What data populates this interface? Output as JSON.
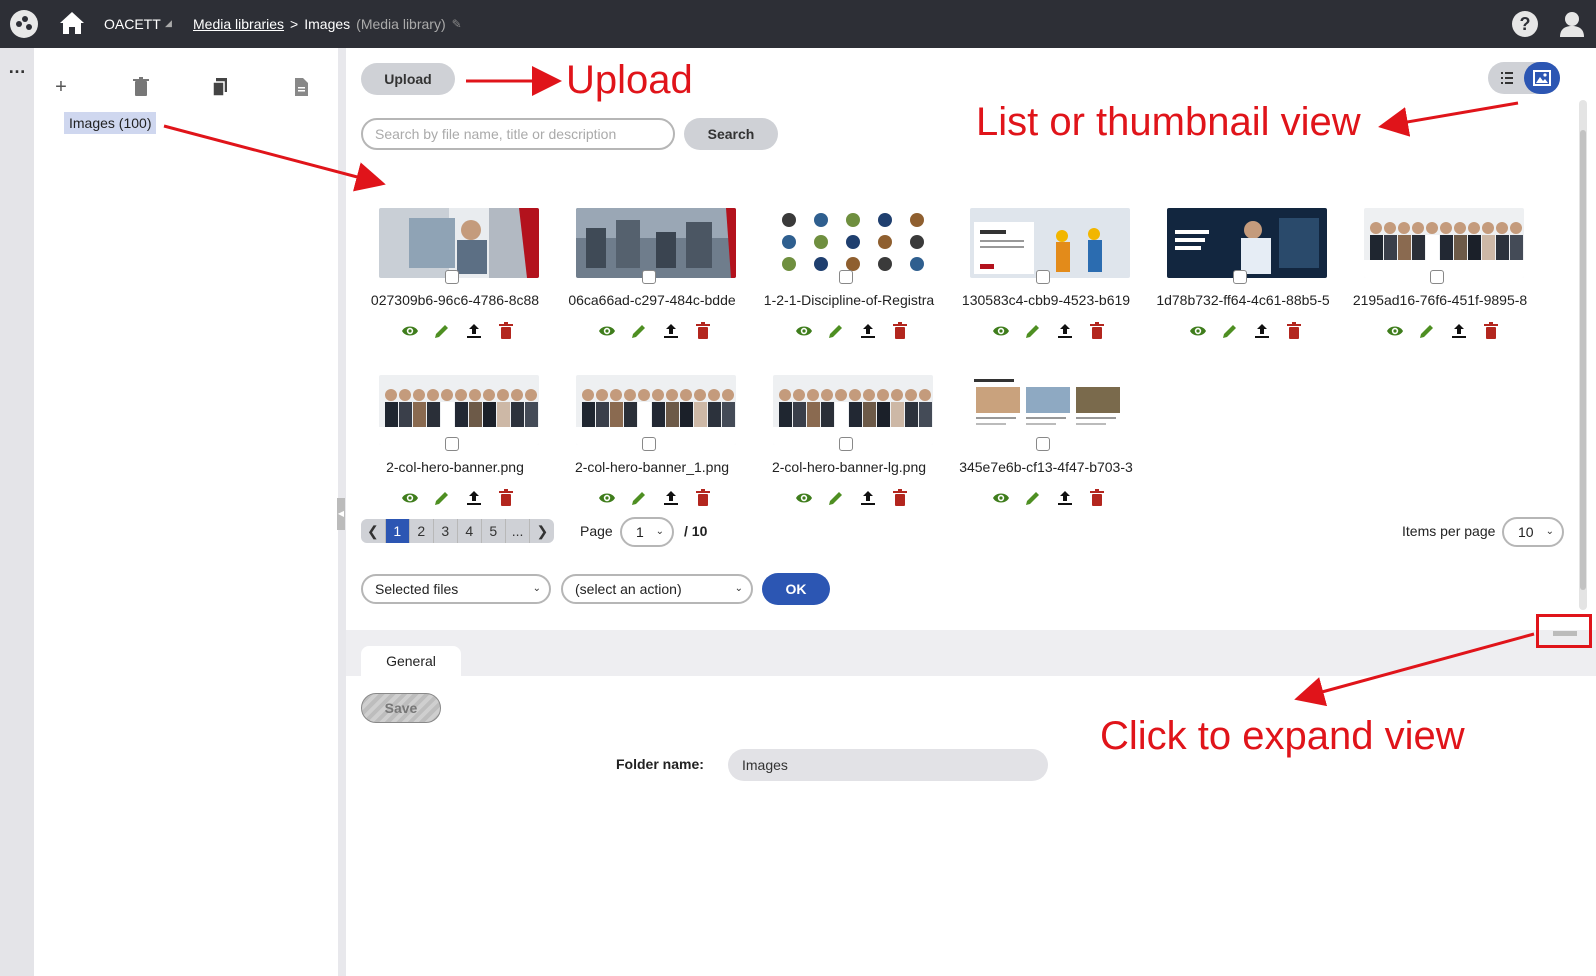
{
  "topbar": {
    "site": "OACETT",
    "breadcrumb": {
      "parent": "Media libraries",
      "separator": ">",
      "current": "Images",
      "current_note": "(Media library)"
    },
    "help": "?"
  },
  "rail": {
    "menu": "…"
  },
  "tree": {
    "tools": {
      "add": "+",
      "delete": "🗑",
      "copy": "❐",
      "doc": "☰"
    },
    "folders": [
      {
        "label": "Images (100)"
      }
    ]
  },
  "toolbar": {
    "upload_label": "Upload",
    "search_placeholder": "Search by file name, title or description",
    "search_label": "Search"
  },
  "files": [
    {
      "name": "027309b6-96c6-4786-8c88",
      "thumb": "lab"
    },
    {
      "name": "06ca66ad-c297-484c-bdde",
      "thumb": "city"
    },
    {
      "name": "1-2-1-Discipline-of-Registra",
      "thumb": "icons"
    },
    {
      "name": "130583c4-cbb9-4523-b619",
      "thumb": "join"
    },
    {
      "name": "1d78b732-ff64-4c61-88b5-5",
      "thumb": "webinar"
    },
    {
      "name": "2195ad16-76f6-451f-9895-8",
      "thumb": "group"
    },
    {
      "name": "2-col-hero-banner.png",
      "thumb": "group"
    },
    {
      "name": "2-col-hero-banner_1.png",
      "thumb": "group"
    },
    {
      "name": "2-col-hero-banner-lg.png",
      "thumb": "group"
    },
    {
      "name": "345e7e6b-cf13-4f47-b703-3",
      "thumb": "news"
    }
  ],
  "pagination": {
    "pages": [
      "1",
      "2",
      "3",
      "4",
      "5",
      "..."
    ],
    "prev": "❮",
    "next": "❯",
    "page_label": "Page",
    "page_value": "1",
    "total": "/ 10",
    "items_per_page_label": "Items per page",
    "items_per_page_value": "10"
  },
  "bulk": {
    "scope_value": "Selected files",
    "action_value": "(select an action)",
    "ok_label": "OK"
  },
  "details": {
    "tab_general": "General",
    "save_label": "Save",
    "folder_name_label": "Folder name:",
    "folder_name_value": "Images"
  },
  "annotations": {
    "upload": "Upload",
    "view": "List or thumbnail view",
    "expand": "Click to expand view"
  },
  "colors": {
    "topbar": "#2d2f36",
    "accent": "#2c56b3",
    "view_green": "#3f7d1c",
    "edit_green": "#4e8f22",
    "delete_red": "#b3261e",
    "annotation_red": "#e0141a"
  }
}
